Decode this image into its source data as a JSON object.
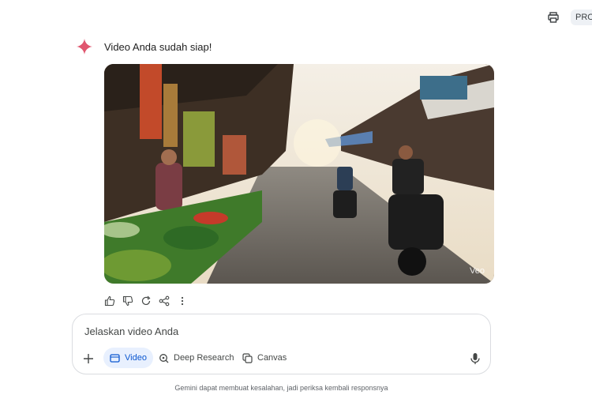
{
  "header": {
    "pro_label": "PRO"
  },
  "response": {
    "text": "Video Anda sudah siap!",
    "video_watermark": "Veo"
  },
  "composer": {
    "placeholder": "Jelaskan video Anda",
    "tools": {
      "video": "Video",
      "deep_research": "Deep Research",
      "canvas": "Canvas"
    }
  },
  "footer": {
    "disclaimer": "Gemini dapat membuat kesalahan, jadi periksa kembali responsnya"
  },
  "colors": {
    "accent": "#0b57d0",
    "spark": "#e0566f"
  }
}
